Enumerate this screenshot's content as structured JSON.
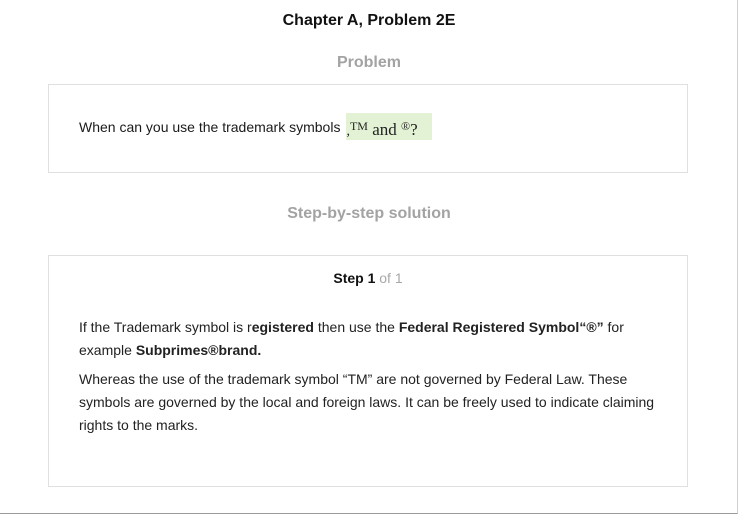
{
  "header": {
    "chapter_title": "Chapter A, Problem 2E"
  },
  "problem": {
    "heading": "Problem",
    "question_text": "When can you use the trademark symbols",
    "symbol_comma": ",",
    "symbol_tm": "TM",
    "symbol_and": " and ",
    "symbol_reg": "®",
    "symbol_question": "?"
  },
  "solution": {
    "heading": "Step-by-step solution",
    "step_word": "Step 1",
    "step_of": " of 1",
    "para1": {
      "t1": "If the Trademark symbol is r",
      "t2": "egistered",
      "t3": " then use the ",
      "t4": "Federal Registered Symbol“®”",
      "t5": " for example ",
      "t6": "Subprimes®brand."
    },
    "para2": "Whereas the use of the trademark symbol “TM” are not governed by Federal Law. These symbols are governed by the local and foreign laws. It can be freely used to indicate claiming rights to the marks."
  },
  "colors": {
    "heading_gray": "#a3a3a3",
    "symbol_highlight": "#e3f2d4",
    "card_border": "#e0e0e0"
  }
}
